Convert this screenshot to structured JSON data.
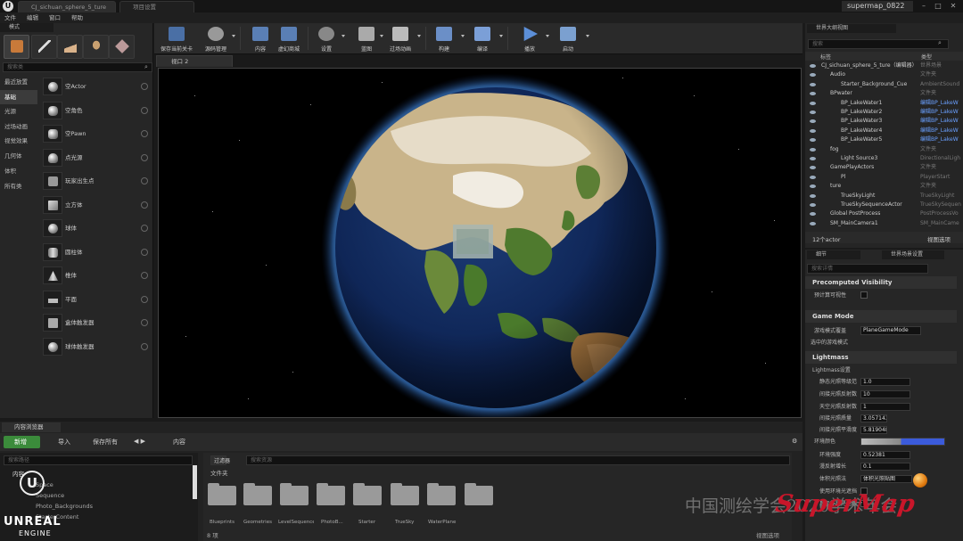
{
  "app": {
    "title": "Unreal Engine",
    "project": "supermap_0822"
  },
  "tabs": [
    "CJ_sichuan_sphere_5_ture",
    "项目设置"
  ],
  "menu": [
    "文件",
    "编辑",
    "窗口",
    "帮助"
  ],
  "modes_panel": {
    "title": "模式",
    "search_placeholder": "搜索类",
    "categories": [
      "最近放置",
      "基础",
      "光源",
      "过场动画",
      "视觉效果",
      "几何体",
      "体积",
      "所有类"
    ],
    "selected_category": "基础",
    "actors": [
      "空Actor",
      "空角色",
      "空Pawn",
      "点光源",
      "玩家出生点",
      "立方体",
      "球体",
      "圆柱体",
      "椎体",
      "平面",
      "盒体触发器",
      "球体触发器"
    ]
  },
  "toolbar": [
    "保存当前关卡",
    "源码管理",
    "内容",
    "虚幻商城",
    "设置",
    "蓝图",
    "过场动画",
    "构建",
    "编译",
    "播放",
    "启动"
  ],
  "viewport": {
    "tab": "视口 2"
  },
  "outliner": {
    "title": "世界大纲视图",
    "search_placeholder": "搜索",
    "col_label": "标签",
    "col_type": "类型",
    "rows": [
      {
        "name": "CJ_sichuan_sphere_5_ture（编辑器）",
        "type": "世界场景"
      },
      {
        "name": "Audio",
        "type": "文件夹"
      },
      {
        "name": "Starter_Background_Cue",
        "type": "AmbientSound"
      },
      {
        "name": "BPwater",
        "type": "文件夹"
      },
      {
        "name": "BP_LakeWater1",
        "type": "编辑BP_LakeW"
      },
      {
        "name": "BP_LakeWater2",
        "type": "编辑BP_LakeW"
      },
      {
        "name": "BP_LakeWater3",
        "type": "编辑BP_LakeW"
      },
      {
        "name": "BP_LakeWater4",
        "type": "编辑BP_LakeW"
      },
      {
        "name": "BP_LakeWater5",
        "type": "编辑BP_LakeW"
      },
      {
        "name": "fog",
        "type": "文件夹"
      },
      {
        "name": "Light Source3",
        "type": "DirectionalLigh"
      },
      {
        "name": "GamePlayActors",
        "type": "文件夹"
      },
      {
        "name": "Pl",
        "type": "PlayerStart"
      },
      {
        "name": "ture",
        "type": "文件夹"
      },
      {
        "name": "TrueSkyLight",
        "type": "TrueSkyLight"
      },
      {
        "name": "TrueSkySequenceActor",
        "type": "TrueSkySequen"
      },
      {
        "name": "Global PostProcess",
        "type": "PostProcessVo"
      },
      {
        "name": "SM_MainCamera1",
        "type": "SM_MainCame"
      }
    ],
    "count": "12个actor",
    "view_options": "视图选项"
  },
  "details": {
    "tab_details": "细节",
    "tab_world": "世界场景设置",
    "search_placeholder": "搜索详情",
    "sections": [
      "Precomputed Visibility",
      "Game Mode",
      "Lightmass"
    ],
    "precomputed_label": "预计算可视性",
    "gamemode_label": "游戏模式覆盖",
    "gamemode_value": "PlaneGameMode",
    "selected_gamemode": "选中的游戏模式",
    "lightmass_settings": "Lightmass设置",
    "props": [
      {
        "label": "静态光照等级范",
        "value": "1.0"
      },
      {
        "label": "间接光照反射数",
        "value": "10"
      },
      {
        "label": "天空光照反射数",
        "value": "1"
      },
      {
        "label": "间接光照质量",
        "value": "3.057143"
      },
      {
        "label": "间接光照平滑度",
        "value": "5.819048"
      },
      {
        "label": "环境颜色",
        "value": ""
      },
      {
        "label": "环境强度",
        "value": "0.52381"
      },
      {
        "label": "漫反射增长",
        "value": "0.1"
      },
      {
        "label": "体积光照法",
        "value": "体积光照贴图"
      },
      {
        "label": "使用环境光遮挡",
        "value": ""
      },
      {
        "label": "显示环境光遮蔽",
        "value": ""
      }
    ]
  },
  "content_browser": {
    "tab": "内容浏览器",
    "new_btn": "新增",
    "import_btn": "导入",
    "save_all": "保存所有",
    "path": "内容",
    "filter": "过滤器",
    "search_placeholder": "搜索资源",
    "tree_search": "搜索路径",
    "tree_root": "内容",
    "tree_items": [
      "Space",
      "Sequence",
      "Photo_Backgrounds",
      "StarterContent"
    ],
    "section_label": "文件夹",
    "folders": [
      "Blueprints",
      "Geometries",
      "LevelSequence",
      "PhotoB...",
      "Starter",
      "TrueSky",
      "WaterPlane",
      ""
    ],
    "count": "8 项",
    "view_options": "视图选项"
  },
  "watermark": "中国测绘学会2020学术年会",
  "brand": "SuperMap",
  "logo_text": [
    "UNREAL",
    "ENGINE"
  ]
}
